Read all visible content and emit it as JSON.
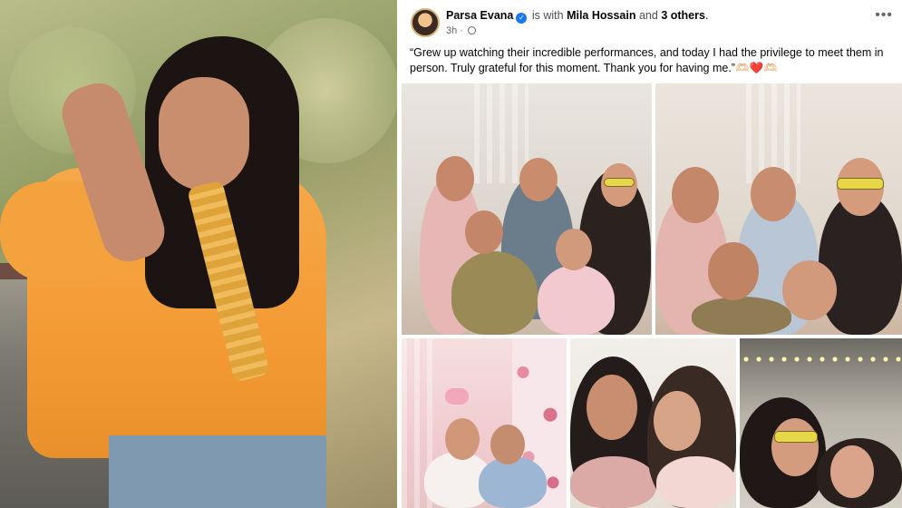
{
  "post": {
    "author": "Parsa Evana",
    "with_text": "is with",
    "tagged": "Mila Hossain",
    "and_text": "and",
    "others": "3 others",
    "period": ".",
    "time": "3h ·",
    "caption": "“Grew up watching their incredible performances, and today I had the privilege to meet them in person. Truly grateful for this moment. Thank you for having me.”",
    "caption_emoji": "🫶🏻❤️🫶🏻",
    "more_label": "•••"
  },
  "icons": {
    "verified": "verified-badge-icon",
    "globe": "globe-icon",
    "more": "more-options-icon"
  },
  "colors": {
    "link_blue": "#1877f2",
    "text": "#050505",
    "muted": "#65676b",
    "top_orange": "#f39a34"
  }
}
